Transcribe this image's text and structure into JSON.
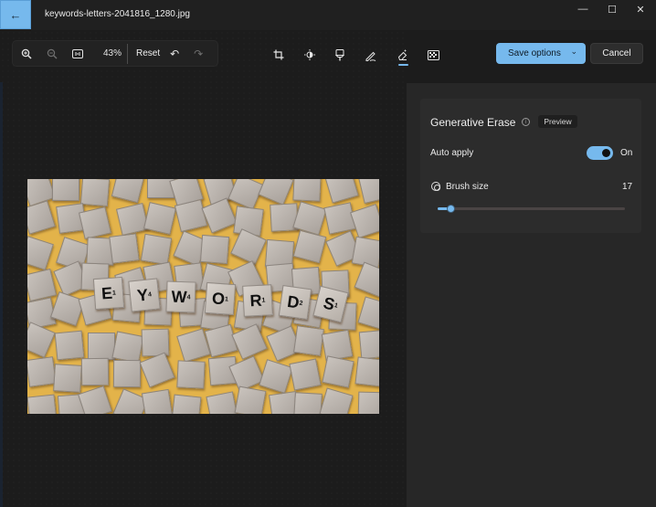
{
  "titlebar": {
    "file_name": "keywords-letters-2041816_1280.jpg",
    "back_icon": "arrow-left-icon",
    "window_controls": [
      "minimize-icon",
      "maximize-icon",
      "close-icon"
    ],
    "window_glyphs": [
      "—",
      "☐",
      "✕"
    ]
  },
  "zoom_toolbar": {
    "zoom_in_icon": "zoom-in-icon",
    "zoom_out_icon": "zoom-out-icon",
    "actual_size_icon": "actual-size-icon",
    "zoom_level": "43%",
    "reset_label": "Reset",
    "undo_icon": "undo-icon",
    "redo_icon": "redo-icon"
  },
  "edit_tools": [
    {
      "name": "crop-icon",
      "glyph": "⌗"
    },
    {
      "name": "adjustment-icon",
      "glyph": "☀"
    },
    {
      "name": "filter-icon",
      "glyph": "♙"
    },
    {
      "name": "markup-icon",
      "glyph": "✎"
    },
    {
      "name": "erase-icon",
      "glyph": "⌫",
      "active": true
    },
    {
      "name": "background-icon",
      "glyph": "▦"
    }
  ],
  "actions": {
    "save_label": "Save options",
    "cancel_label": "Cancel"
  },
  "panel": {
    "title": "Generative Erase",
    "info_glyph": "i",
    "badge": "Preview",
    "auto_apply_label": "Auto apply",
    "auto_apply_state": "On",
    "auto_apply_on": true,
    "brush_label": "Brush size",
    "brush_value": "17",
    "brush_fraction": 0.07
  },
  "photo": {
    "description": "Scrabble tiles spelling KEYWORDS on yellow background",
    "letters": [
      "E",
      "Y",
      "W",
      "O",
      "R",
      "D",
      "S"
    ],
    "subscripts": [
      "1",
      "4",
      "4",
      "1",
      "1",
      "2",
      "1"
    ]
  },
  "colors": {
    "accent": "#76b9ed",
    "background": "#1c1c1c",
    "panel": "#272727"
  }
}
